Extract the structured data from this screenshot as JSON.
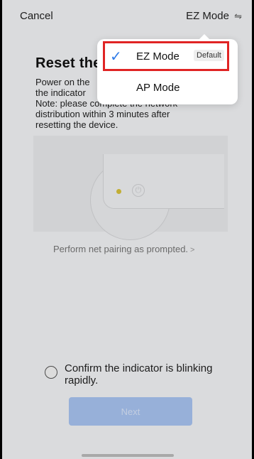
{
  "topbar": {
    "cancel_label": "Cancel",
    "mode_label": "EZ Mode",
    "swap_icon": "⇋"
  },
  "content": {
    "title": "Reset the",
    "desc_lines": [
      "Power on the",
      "the indicator",
      "Note: please complete the network",
      "distribution within 3 minutes after",
      "resetting the device."
    ],
    "pairing_link": "Perform net pairing as prompted.",
    "pairing_chevron": ">",
    "confirm_text": "Confirm the indicator is blinking rapidly.",
    "next_label": "Next"
  },
  "dropdown": {
    "items": [
      {
        "label": "EZ Mode",
        "badge": "Default",
        "selected": true
      },
      {
        "label": "AP Mode",
        "selected": false
      }
    ]
  },
  "colors": {
    "accent": "#2f7be8",
    "highlight": "#e02424",
    "next_button": "#a9c4f2"
  }
}
